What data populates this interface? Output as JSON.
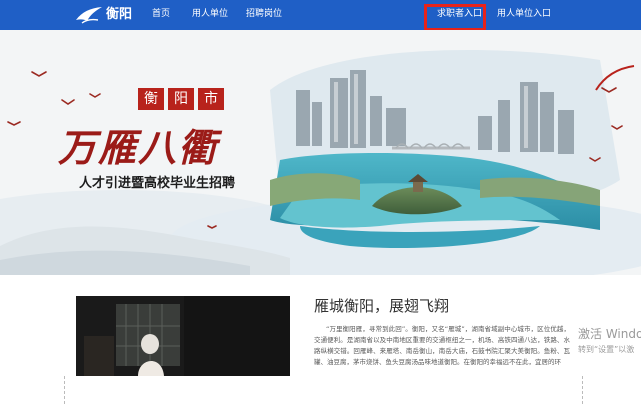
{
  "nav": {
    "logo_text": "衡阳",
    "links": [
      "首页",
      "用人单位",
      "招聘岗位"
    ],
    "seeker_entry": "求职者入口",
    "employer_entry": "用人单位入口"
  },
  "banner": {
    "city_tags": [
      "衡",
      "阳",
      "市"
    ],
    "slogan": "万雁八衢",
    "subtitle": "人才引进暨高校毕业生招聘"
  },
  "intro": {
    "title": "雁城衡阳，展翅飞翔",
    "body": "“万里衡阳雁，寻常到此回”。衡阳，又名“雁城”，湖南省域副中心城市，区位优越，交通便利。是湖南省以及中南地区重要的交通枢纽之一，机场、高铁四通八达，铁路、水路纵横交错。回雁峰、来雁塔、南岳衡山，南岳大庙，石鼓书院汇聚大美衡阳。鱼粉、瓦罐、油豆腐，茅市烧饼、鱼头豆腐汤品味地道衡阳。在衡阳的幸福远不在此，宜居的环"
  },
  "watermark": {
    "line1": "激活 Windo",
    "line2": "转到“设置”以激"
  }
}
